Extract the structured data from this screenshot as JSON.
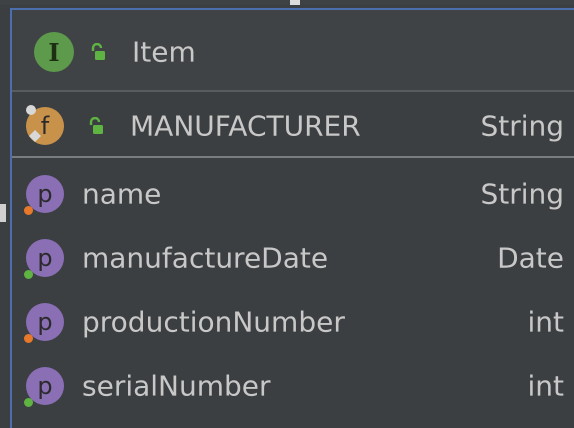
{
  "class": {
    "icon": "interface-icon",
    "icon_letter": "I",
    "name": "Item"
  },
  "constant": {
    "icon": "static-final-field-icon",
    "icon_letter": "f",
    "name": "MANUFACTURER",
    "type": "String"
  },
  "properties": [
    {
      "icon": "property-icon",
      "icon_letter": "p",
      "name": "name",
      "type": "String",
      "marker": "orange"
    },
    {
      "icon": "property-icon",
      "icon_letter": "p",
      "name": "manufactureDate",
      "type": "Date",
      "marker": "green"
    },
    {
      "icon": "property-icon",
      "icon_letter": "p",
      "name": "productionNumber",
      "type": "int",
      "marker": "orange"
    },
    {
      "icon": "property-icon",
      "icon_letter": "p",
      "name": "serialNumber",
      "type": "int",
      "marker": "green"
    }
  ],
  "colors": {
    "accent_border": "#4b6eaf",
    "lock_green": "#5fb342",
    "marker_orange": "#e8792b",
    "marker_green": "#5fb342"
  }
}
